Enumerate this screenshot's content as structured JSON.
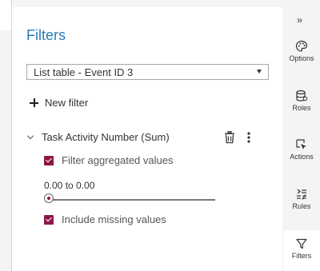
{
  "panel": {
    "title": "Filters",
    "dropdown": {
      "selected": "List table - Event ID 3"
    },
    "new_filter_label": "New filter",
    "filter": {
      "name": "Task Activity Number (Sum)",
      "filter_aggregated_label": "Filter aggregated values",
      "filter_aggregated_checked": true,
      "range_text": "0.00 to 0.00",
      "slider_value": 0.0,
      "include_missing_label": "Include missing values",
      "include_missing_checked": true
    }
  },
  "rail": {
    "collapse_glyph": "››",
    "items": [
      {
        "label": "Options",
        "icon": "palette-icon"
      },
      {
        "label": "Roles",
        "icon": "database-icon"
      },
      {
        "label": "Actions",
        "icon": "cursor-icon"
      },
      {
        "label": "Rules",
        "icon": "rules-icon"
      },
      {
        "label": "Filters",
        "icon": "funnel-icon"
      }
    ]
  },
  "colors": {
    "title_blue": "#2a7ab8",
    "checkbox_accent": "#8b1846",
    "rail_background": "#f4f4f4"
  }
}
